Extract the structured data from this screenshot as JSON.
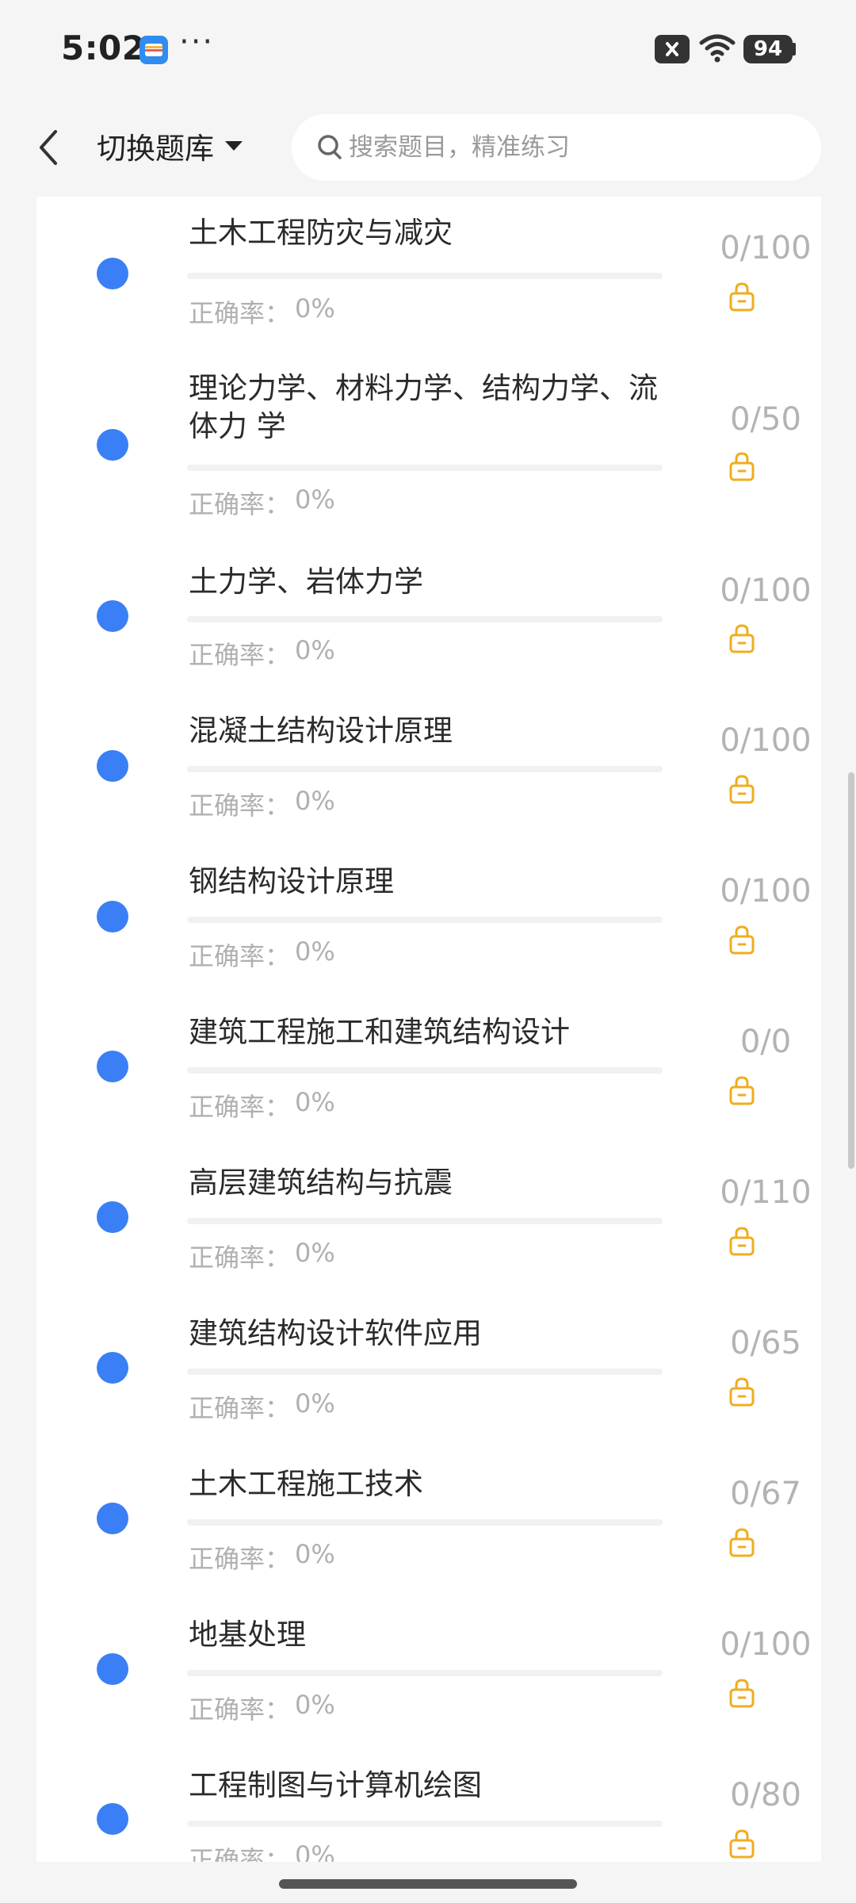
{
  "status_bar": {
    "time": "5:02",
    "dots": "···",
    "battery": "94"
  },
  "header": {
    "bank_switch_label": "切换题库",
    "search_placeholder": "搜索题目，精准练习"
  },
  "accuracy_label": "正确率：",
  "topics": [
    {
      "title": "土木工程防灾与减灾",
      "accuracy": "0%",
      "count": "0/100",
      "progress": 0
    },
    {
      "title": "理论力学、材料力学、结构力学、流体力 学",
      "accuracy": "0%",
      "count": "0/50",
      "progress": 0
    },
    {
      "title": "土力学、岩体力学",
      "accuracy": "0%",
      "count": "0/100",
      "progress": 0
    },
    {
      "title": "混凝土结构设计原理",
      "accuracy": "0%",
      "count": "0/100",
      "progress": 0
    },
    {
      "title": "钢结构设计原理",
      "accuracy": "0%",
      "count": "0/100",
      "progress": 0
    },
    {
      "title": "建筑工程施工和建筑结构设计",
      "accuracy": "0%",
      "count": "0/0",
      "progress": 0
    },
    {
      "title": "高层建筑结构与抗震",
      "accuracy": "0%",
      "count": "0/110",
      "progress": 0
    },
    {
      "title": "建筑结构设计软件应用",
      "accuracy": "0%",
      "count": "0/65",
      "progress": 0
    },
    {
      "title": "土木工程施工技术",
      "accuracy": "0%",
      "count": "0/67",
      "progress": 0
    },
    {
      "title": "地基处理",
      "accuracy": "0%",
      "count": "0/100",
      "progress": 0
    },
    {
      "title": "工程制图与计算机绘图",
      "accuracy": "0%",
      "count": "0/80",
      "progress": 0
    }
  ],
  "colors": {
    "accent": "#3a7ff6",
    "lock": "#f0ad1e",
    "muted_text": "#b0b0b0"
  },
  "icons": {
    "back": "chevron-left-icon",
    "caret": "caret-down-icon",
    "search": "search-icon",
    "lock": "lock-icon"
  }
}
